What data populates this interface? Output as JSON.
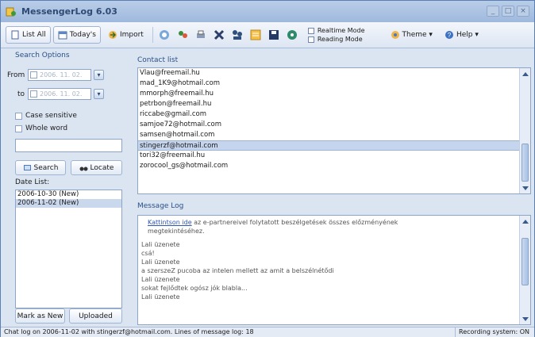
{
  "window": {
    "title": "MessengerLog 6.03"
  },
  "toolbar": {
    "list_all": "List All",
    "todays": "Today's",
    "import": "Import",
    "realtime_mode": "Realtime Mode",
    "reading_mode": "Reading Mode",
    "theme": "Theme",
    "help": "Help"
  },
  "search": {
    "header": "Search Options",
    "from_label": "From",
    "to_label": "to",
    "from_value": "2006. 11. 02.",
    "to_value": "2006. 11. 02.",
    "case_sensitive": "Case sensitive",
    "whole_word": "Whole word",
    "search_btn": "Search",
    "locate_btn": "Locate",
    "datelist_label": "Date List:",
    "dates": [
      "2006-10-30 (New)",
      "2006-11-02 (New)"
    ],
    "mark_as_new": "Mark as New",
    "uploaded": "Uploaded"
  },
  "contacts": {
    "header": "Contact list",
    "items": [
      "Vlau@freemail.hu",
      "mad_1K9@hotmail.com",
      "mmorph@freemail.hu",
      "petrbon@freemail.hu",
      "riccabe@gmail.com",
      "samjoe72@hotmail.com",
      "samsen@hotmail.com",
      "stingerzf@hotmail.com",
      "tori32@freemail.hu",
      "zorocool_gs@hotmail.com"
    ],
    "selected_index": 7
  },
  "message_log": {
    "header": "Message Log",
    "link_text": "Kattintson ide",
    "intro_rest": " az e-partnereivel folytatott beszélgetések összes előzményének",
    "intro_line2": "megtekintéséhez.",
    "lines": [
      "Lali üzenete",
      "   csá!",
      "Lali üzenete",
      "   a szerszeZ pucoba az intelen mellett az amit a belszélnétődi",
      "Lali üzenete",
      "   sokat fejlődtek ogósz jók blabla...",
      "Lali üzenete"
    ]
  },
  "status": {
    "left": "Chat log on 2006-11-02 with stingerzf@hotmail.com. Lines of message log: 18",
    "right": "Recording system: ON"
  }
}
